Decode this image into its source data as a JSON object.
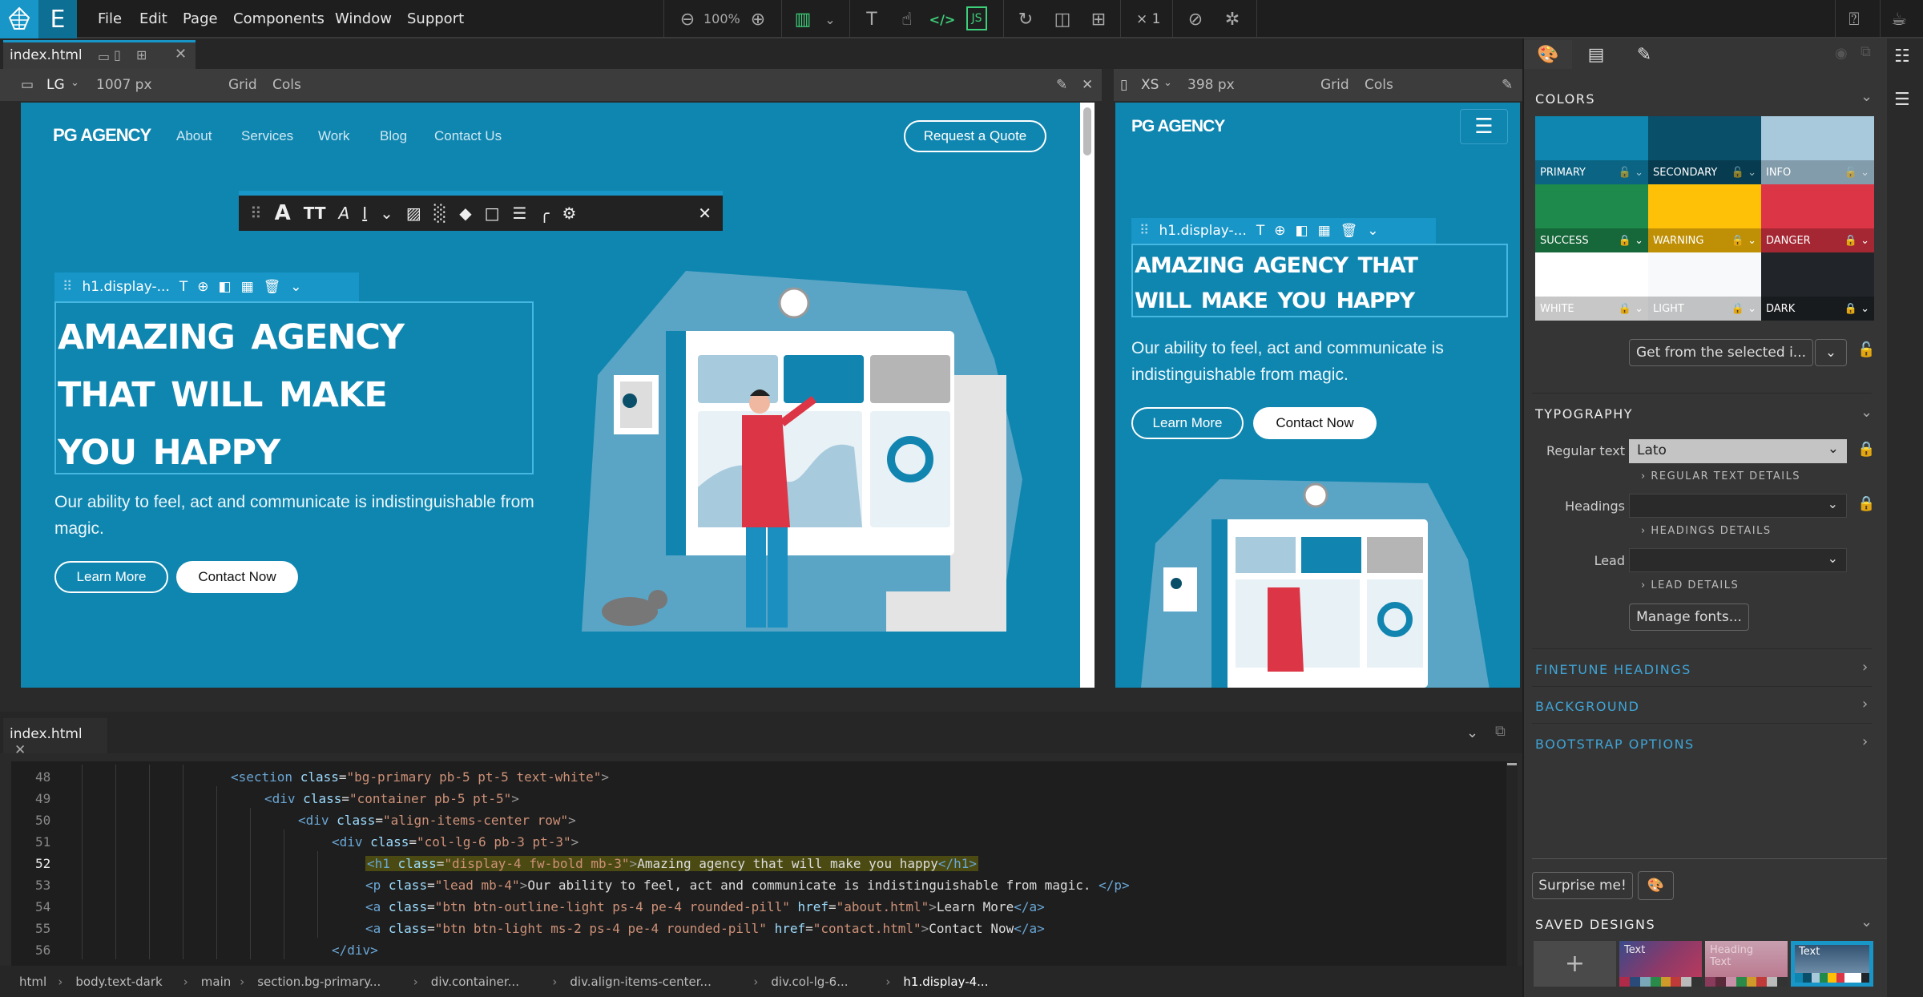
{
  "menubar": {
    "items": [
      "File",
      "Edit",
      "Page",
      "Components",
      "Window",
      "Support"
    ],
    "zoom": "100%",
    "multiplier": "× 1",
    "icons": [
      "zoom-out-icon",
      "zoom-in-icon",
      "layout-icon",
      "text-cursor-icon",
      "hand-pointer-icon",
      "code-icon",
      "js-icon",
      "refresh-icon",
      "preview-icon",
      "add-page-icon",
      "hide-icon",
      "target-icon",
      "help-icon",
      "coffee-icon"
    ]
  },
  "doc_tab": {
    "title": "index.html"
  },
  "lg_view": {
    "size": "LG",
    "width": "1007 px",
    "grid": "Grid",
    "cols": "Cols"
  },
  "xs_view": {
    "size": "XS",
    "width": "398 px",
    "grid": "Grid",
    "cols": "Cols"
  },
  "site": {
    "brand": "PG AGENCY",
    "nav": [
      "About",
      "Services",
      "Work",
      "Blog",
      "Contact Us"
    ],
    "cta": "Request a Quote",
    "heading_lines_lg": [
      "Amazing agency",
      "that will make",
      "you happy"
    ],
    "heading_lines_xs": [
      "Amazing agency that",
      "will make you happy"
    ],
    "lead": "Our ability to feel, act and communicate is indistinguishable from magic.",
    "btn_learn": "Learn More",
    "btn_contact": "Contact Now"
  },
  "selection": {
    "label": "h1.display-..."
  },
  "code": {
    "tab": "index.html",
    "lines": [
      {
        "n": "48",
        "indent": 5,
        "html": "<span class='tag'>&lt;section</span> <span class='attr'>class</span>=<span class='str'>\"bg-primary pb-5 pt-5 text-white\"</span><span class='pun'>&gt;</span>"
      },
      {
        "n": "49",
        "indent": 6,
        "html": "<span class='tag'>&lt;div</span> <span class='attr'>class</span>=<span class='str'>\"container pb-5 pt-5\"</span><span class='pun'>&gt;</span>"
      },
      {
        "n": "50",
        "indent": 7,
        "html": "<span class='tag'>&lt;div</span> <span class='attr'>class</span>=<span class='str'>\"align-items-center row\"</span><span class='pun'>&gt;</span>"
      },
      {
        "n": "51",
        "indent": 8,
        "html": "<span class='tag'>&lt;div</span> <span class='attr'>class</span>=<span class='str'>\"col-lg-6 pb-3 pt-3\"</span><span class='pun'>&gt;</span>"
      },
      {
        "n": "52",
        "indent": 9,
        "hl": true,
        "html": "<span class='tag'>&lt;h1</span> <span class='attr'>class</span>=<span class='str'>\"display-4 fw-bold mb-3\"</span><span class='pun'>&gt;</span>Amazing agency that will make you happy<span class='tag'>&lt;/h1&gt;</span>"
      },
      {
        "n": "53",
        "indent": 9,
        "html": "<span class='tag'>&lt;p</span> <span class='attr'>class</span>=<span class='str'>\"lead mb-4\"</span><span class='pun'>&gt;</span>Our ability to feel, act and communicate is indistinguishable from magic. <span class='tag'>&lt;/p&gt;</span>"
      },
      {
        "n": "54",
        "indent": 9,
        "html": "<span class='tag'>&lt;a</span> <span class='attr'>class</span>=<span class='str'>\"btn btn-outline-light ps-4 pe-4 rounded-pill\"</span> <span class='attr'>href</span>=<span class='str'>\"about.html\"</span><span class='pun'>&gt;</span>Learn More<span class='tag'>&lt;/a&gt;</span>"
      },
      {
        "n": "55",
        "indent": 9,
        "html": "<span class='tag'>&lt;a</span> <span class='attr'>class</span>=<span class='str'>\"btn btn-light ms-2 ps-4 pe-4 rounded-pill\"</span> <span class='attr'>href</span>=<span class='str'>\"contact.html\"</span><span class='pun'>&gt;</span>Contact Now<span class='tag'>&lt;/a&gt;</span>"
      },
      {
        "n": "56",
        "indent": 8,
        "html": "<span class='tag'>&lt;/div&gt;</span>"
      }
    ]
  },
  "breadcrumbs": [
    "html",
    "body.text-dark",
    "main",
    "section.bg-primary...",
    "div.container...",
    "div.align-items-center...",
    "div.col-lg-6...",
    "h1.display-4..."
  ],
  "panel": {
    "colors_title": "COLORS",
    "swatches": [
      {
        "name": "PRIMARY",
        "color": "#0f86b0",
        "locked": false
      },
      {
        "name": "SECONDARY",
        "color": "#0a4f6a",
        "locked": false
      },
      {
        "name": "INFO",
        "color": "#a8c8dc",
        "locked": false
      },
      {
        "name": "SUCCESS",
        "color": "#1e8a4c",
        "locked": true
      },
      {
        "name": "WARNING",
        "color": "#ffc107",
        "locked": true
      },
      {
        "name": "DANGER",
        "color": "#dc3545",
        "locked": true
      },
      {
        "name": "WHITE",
        "color": "#ffffff",
        "locked": true
      },
      {
        "name": "LIGHT",
        "color": "#f8f9fa",
        "locked": true
      },
      {
        "name": "DARK",
        "color": "#212529",
        "locked": true
      }
    ],
    "get_from_selected": "Get from the selected i...",
    "typography_title": "TYPOGRAPHY",
    "regular_label": "Regular text",
    "regular_value": "Lato",
    "regular_details": "REGULAR TEXT DETAILS",
    "headings_label": "Headings",
    "headings_value": "",
    "headings_details": "HEADINGS DETAILS",
    "lead_label": "Lead",
    "lead_value": "",
    "lead_details": "LEAD DETAILS",
    "manage_fonts": "Manage fonts...",
    "finetune": "FINETUNE HEADINGS",
    "background": "BACKGROUND",
    "bootstrap": "BOOTSTRAP OPTIONS",
    "surprise": "Surprise me!",
    "saved_title": "SAVED DESIGNS",
    "saved": [
      {
        "label": "+"
      },
      {
        "label": "Text"
      },
      {
        "label": "Heading Text"
      },
      {
        "label": "Text",
        "selected": true
      }
    ]
  }
}
